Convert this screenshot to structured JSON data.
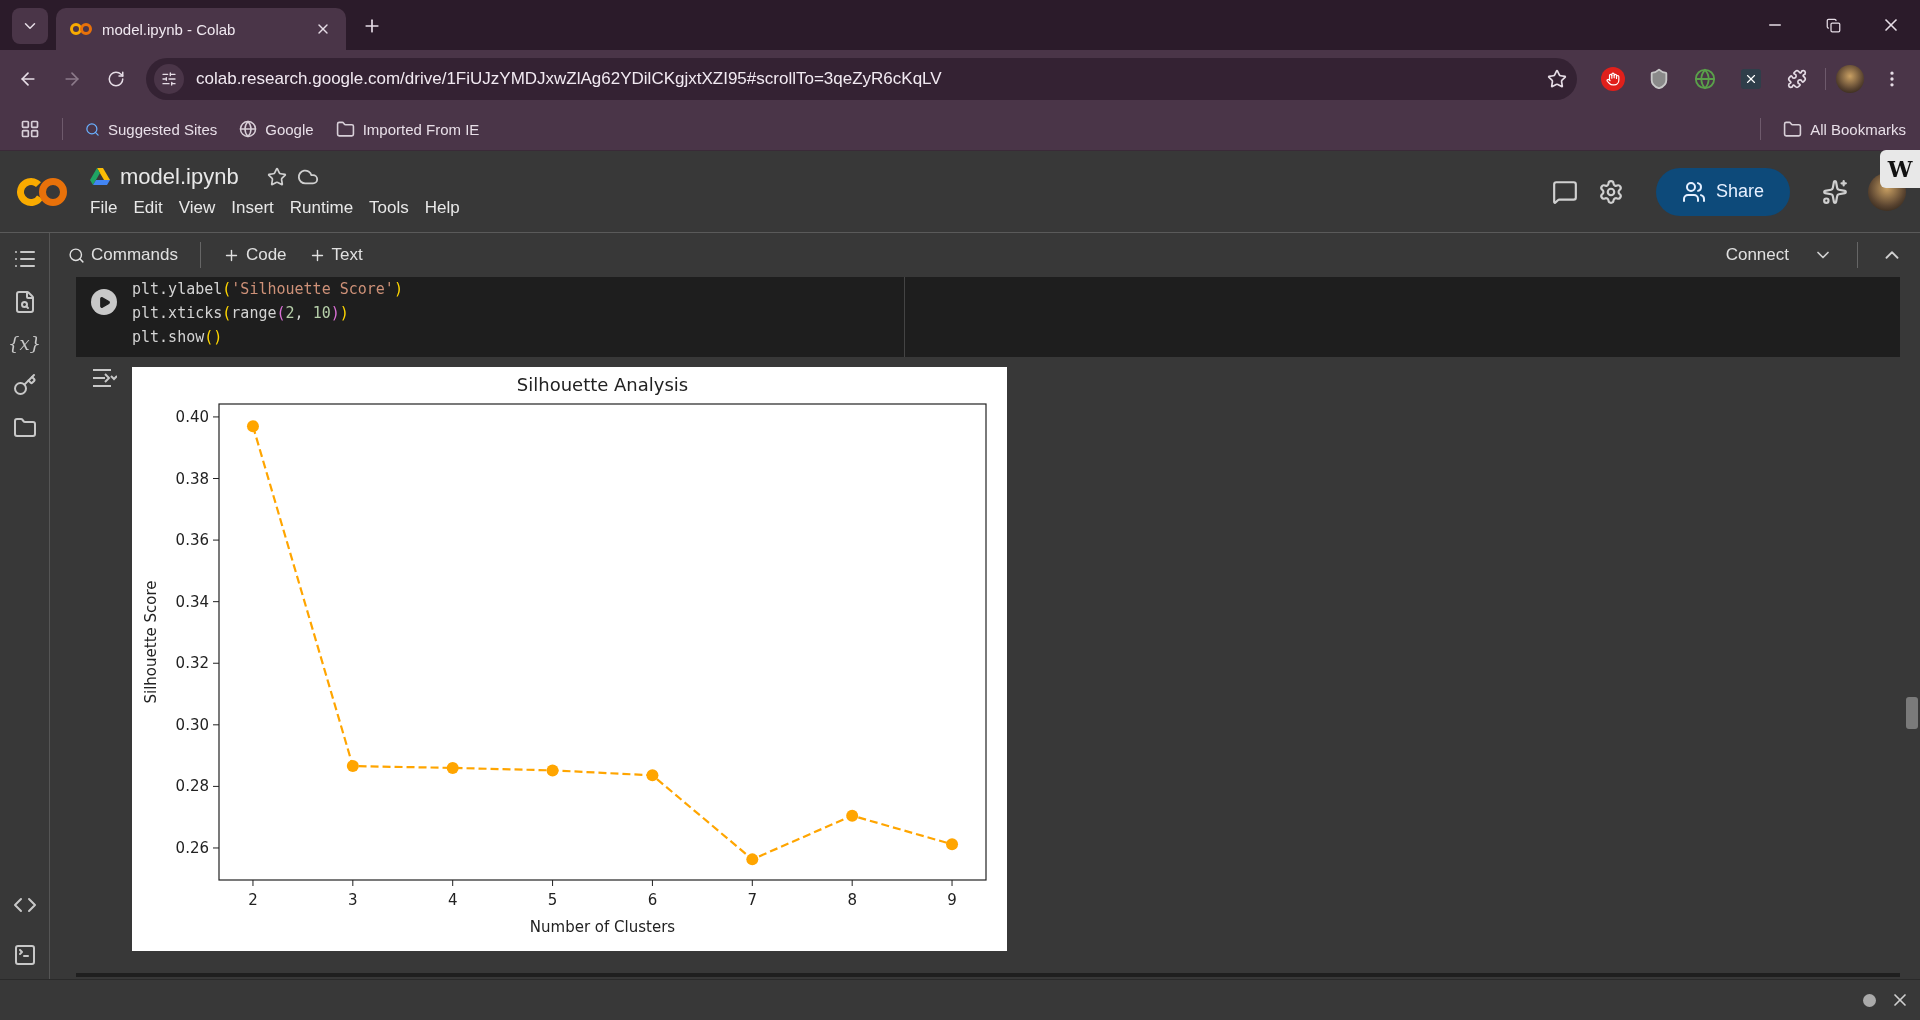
{
  "browser": {
    "tab": {
      "title": "model.ipynb - Colab",
      "selected": true
    },
    "url": "colab.research.google.com/drive/1FiUJzYMDJxwZlAg62YDilCKgjxtXZI95#scrollTo=3qeZyR6cKqLV",
    "bookmarks": [
      "Suggested Sites",
      "Google",
      "Imported From IE"
    ],
    "all_bookmarks": "All Bookmarks"
  },
  "sidebar": {
    "variables_label": "{x}"
  },
  "notebook": {
    "title": "model.ipynb",
    "menu": [
      "File",
      "Edit",
      "View",
      "Insert",
      "Runtime",
      "Tools",
      "Help"
    ],
    "share": "Share",
    "badge": "W"
  },
  "toolbar": {
    "commands": "Commands",
    "add_code": "Code",
    "add_text": "Text",
    "connect": "Connect"
  },
  "cell": {
    "lines": [
      [
        {
          "kind": "plain",
          "text": "plt.ylabel"
        },
        {
          "kind": "paren",
          "text": "("
        },
        {
          "kind": "string",
          "text": "'Silhouette Score'"
        },
        {
          "kind": "paren",
          "text": ")"
        }
      ],
      [
        {
          "kind": "plain",
          "text": "plt.xticks"
        },
        {
          "kind": "paren",
          "text": "("
        },
        {
          "kind": "plain",
          "text": "range"
        },
        {
          "kind": "paren2",
          "text": "("
        },
        {
          "kind": "number",
          "text": "2"
        },
        {
          "kind": "plain",
          "text": ", "
        },
        {
          "kind": "number",
          "text": "10"
        },
        {
          "kind": "paren2",
          "text": ")"
        },
        {
          "kind": "paren",
          "text": ")"
        }
      ],
      [
        {
          "kind": "plain",
          "text": "plt.show"
        },
        {
          "kind": "paren",
          "text": "()"
        }
      ]
    ]
  },
  "output": {
    "chart_data": {
      "type": "line",
      "title": "Silhouette Analysis",
      "xlabel": "Number of Clusters",
      "ylabel": "Silhouette Score",
      "x": [
        2,
        3,
        4,
        5,
        6,
        7,
        8,
        9
      ],
      "series": [
        {
          "color": "#ffa500",
          "line_style": "dashed",
          "marker": "o",
          "values": [
            0.397,
            0.2866,
            0.286,
            0.2852,
            0.2836,
            0.2563,
            0.2705,
            0.2612
          ]
        }
      ],
      "xlim": [
        1.66,
        9.34
      ],
      "ylim": [
        0.2496,
        0.4042
      ],
      "xticks": [
        2,
        3,
        4,
        5,
        6,
        7,
        8,
        9
      ],
      "yticks": [
        {
          "value": 0.26,
          "label": "0.26"
        },
        {
          "value": 0.28,
          "label": "0.28"
        },
        {
          "value": 0.3,
          "label": "0.30"
        },
        {
          "value": 0.32,
          "label": "0.32"
        },
        {
          "value": 0.34,
          "label": "0.34"
        },
        {
          "value": 0.36,
          "label": "0.36"
        },
        {
          "value": 0.38,
          "label": "0.38"
        },
        {
          "value": 0.4,
          "label": "0.40"
        }
      ]
    }
  }
}
